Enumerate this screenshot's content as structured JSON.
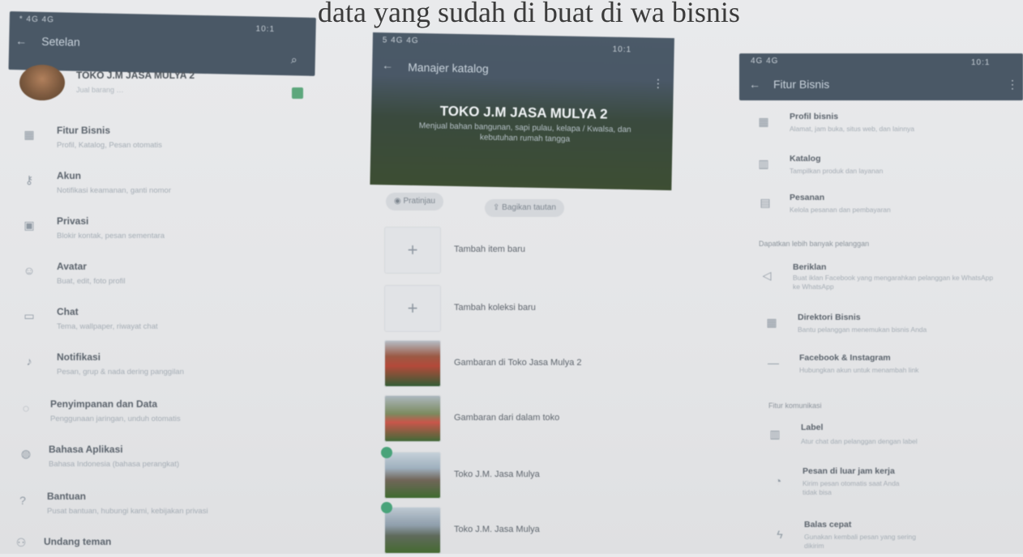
{
  "caption": "data yang sudah di buat di wa bisnis",
  "left_panel": {
    "status": "* 4G 4G",
    "status_right": "10:1",
    "title": "Setelan",
    "profile_name": "TOKO J.M JASA MULYA 2",
    "profile_sub": "Jual barang …",
    "items": [
      {
        "icon": "store",
        "label": "Fitur Bisnis",
        "sub": "Profil, Katalog, Pesan otomatis"
      },
      {
        "icon": "key",
        "label": "Akun",
        "sub": "Notifikasi keamanan, ganti nomor"
      },
      {
        "icon": "lock",
        "label": "Privasi",
        "sub": "Blokir kontak, pesan sementara"
      },
      {
        "icon": "avatar",
        "label": "Avatar",
        "sub": "Buat, edit, foto profil"
      },
      {
        "icon": "chat",
        "label": "Chat",
        "sub": "Tema, wallpaper, riwayat chat"
      },
      {
        "icon": "bell",
        "label": "Notifikasi",
        "sub": "Pesan, grup & nada dering panggilan"
      },
      {
        "icon": "storage",
        "label": "Penyimpanan dan Data",
        "sub": "Penggunaan jaringan, unduh otomatis"
      },
      {
        "icon": "globe",
        "label": "Bahasa Aplikasi",
        "sub": "Bahasa Indonesia (bahasa perangkat)"
      },
      {
        "icon": "help",
        "label": "Bantuan",
        "sub": "Pusat bantuan, hubungi kami, kebijakan privasi"
      },
      {
        "icon": "people",
        "label": "Undang teman",
        "sub": ""
      }
    ]
  },
  "middle_panel": {
    "status": "5 4G 4G",
    "status_right": "10:1",
    "title": "Manajer katalog",
    "hero_title": "TOKO J.M JASA MULYA 2",
    "hero_desc": "Menjual bahan bangunan, sapi pulau, kelapa / Kwalsa, dan kebutuhan rumah tangga",
    "chips": [
      "Pratinjau",
      "Bagikan tautan"
    ],
    "items": [
      {
        "type": "add",
        "label": "Tambah item baru"
      },
      {
        "type": "add",
        "label": "Tambah koleksi baru"
      },
      {
        "type": "photo",
        "label": "Gambaran di Toko Jasa Mulya 2"
      },
      {
        "type": "photo",
        "label": "Gambaran dari dalam toko"
      },
      {
        "type": "photo",
        "label": "Toko J.M. Jasa Mulya"
      },
      {
        "type": "photo",
        "label": "Toko J.M. Jasa Mulya"
      }
    ]
  },
  "right_panel": {
    "status": "4G 4G",
    "status_right": "10:1",
    "title": "Fitur Bisnis",
    "items_top": [
      {
        "icon": "store",
        "label": "Profil bisnis",
        "sub": "Alamat, jam buka, situs web, dan lainnya"
      },
      {
        "icon": "catalog",
        "label": "Katalog",
        "sub": "Tampilkan produk dan layanan"
      },
      {
        "icon": "orders",
        "label": "Pesanan",
        "sub": "Kelola pesanan dan pembayaran"
      }
    ],
    "section1": "Dapatkan lebih banyak pelanggan",
    "items_mid": [
      {
        "icon": "megaphone",
        "label": "Beriklan",
        "sub": "Buat iklan Facebook yang mengarahkan pelanggan ke WhatsApp",
        "sub2": "ke WhatsApp"
      },
      {
        "icon": "grid",
        "label": "Direktori Bisnis",
        "sub": "Bantu pelanggan menemukan bisnis Anda"
      },
      {
        "icon": "link",
        "label": "Facebook & Instagram",
        "sub": "Hubungkan akun untuk menambah link"
      }
    ],
    "section2": "Fitur komunikasi",
    "items_bot": [
      {
        "icon": "labels",
        "label": "Label",
        "sub": "Atur chat dan pelanggan dengan label"
      },
      {
        "icon": "clock",
        "label": "Pesan di luar jam kerja",
        "sub": "Kirim pesan otomatis saat Anda",
        "sub2": "tidak bisa"
      },
      {
        "icon": "lightning",
        "label": "Balas cepat",
        "sub": "Gunakan kembali pesan yang sering",
        "sub2": "dikirim"
      }
    ]
  }
}
